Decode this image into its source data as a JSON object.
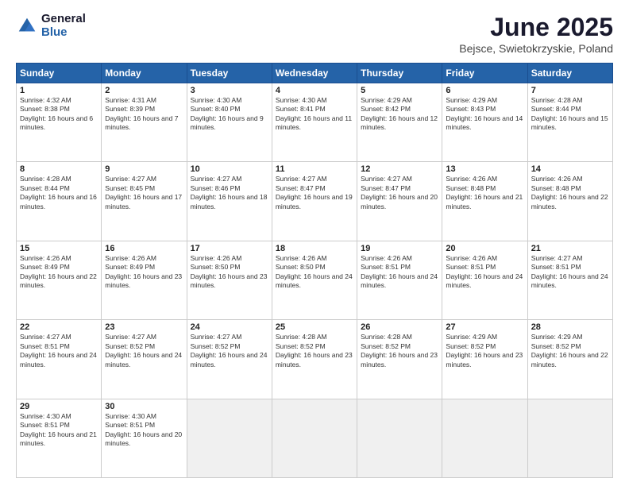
{
  "header": {
    "logo_line1": "General",
    "logo_line2": "Blue",
    "month": "June 2025",
    "location": "Bejsce, Swietokrzyskie, Poland"
  },
  "days_of_week": [
    "Sunday",
    "Monday",
    "Tuesday",
    "Wednesday",
    "Thursday",
    "Friday",
    "Saturday"
  ],
  "weeks": [
    [
      {
        "day": "1",
        "sunrise": "4:32 AM",
        "sunset": "8:38 PM",
        "daylight": "16 hours and 6 minutes."
      },
      {
        "day": "2",
        "sunrise": "4:31 AM",
        "sunset": "8:39 PM",
        "daylight": "16 hours and 7 minutes."
      },
      {
        "day": "3",
        "sunrise": "4:30 AM",
        "sunset": "8:40 PM",
        "daylight": "16 hours and 9 minutes."
      },
      {
        "day": "4",
        "sunrise": "4:30 AM",
        "sunset": "8:41 PM",
        "daylight": "16 hours and 11 minutes."
      },
      {
        "day": "5",
        "sunrise": "4:29 AM",
        "sunset": "8:42 PM",
        "daylight": "16 hours and 12 minutes."
      },
      {
        "day": "6",
        "sunrise": "4:29 AM",
        "sunset": "8:43 PM",
        "daylight": "16 hours and 14 minutes."
      },
      {
        "day": "7",
        "sunrise": "4:28 AM",
        "sunset": "8:44 PM",
        "daylight": "16 hours and 15 minutes."
      }
    ],
    [
      {
        "day": "8",
        "sunrise": "4:28 AM",
        "sunset": "8:44 PM",
        "daylight": "16 hours and 16 minutes."
      },
      {
        "day": "9",
        "sunrise": "4:27 AM",
        "sunset": "8:45 PM",
        "daylight": "16 hours and 17 minutes."
      },
      {
        "day": "10",
        "sunrise": "4:27 AM",
        "sunset": "8:46 PM",
        "daylight": "16 hours and 18 minutes."
      },
      {
        "day": "11",
        "sunrise": "4:27 AM",
        "sunset": "8:47 PM",
        "daylight": "16 hours and 19 minutes."
      },
      {
        "day": "12",
        "sunrise": "4:27 AM",
        "sunset": "8:47 PM",
        "daylight": "16 hours and 20 minutes."
      },
      {
        "day": "13",
        "sunrise": "4:26 AM",
        "sunset": "8:48 PM",
        "daylight": "16 hours and 21 minutes."
      },
      {
        "day": "14",
        "sunrise": "4:26 AM",
        "sunset": "8:48 PM",
        "daylight": "16 hours and 22 minutes."
      }
    ],
    [
      {
        "day": "15",
        "sunrise": "4:26 AM",
        "sunset": "8:49 PM",
        "daylight": "16 hours and 22 minutes."
      },
      {
        "day": "16",
        "sunrise": "4:26 AM",
        "sunset": "8:49 PM",
        "daylight": "16 hours and 23 minutes."
      },
      {
        "day": "17",
        "sunrise": "4:26 AM",
        "sunset": "8:50 PM",
        "daylight": "16 hours and 23 minutes."
      },
      {
        "day": "18",
        "sunrise": "4:26 AM",
        "sunset": "8:50 PM",
        "daylight": "16 hours and 24 minutes."
      },
      {
        "day": "19",
        "sunrise": "4:26 AM",
        "sunset": "8:51 PM",
        "daylight": "16 hours and 24 minutes."
      },
      {
        "day": "20",
        "sunrise": "4:26 AM",
        "sunset": "8:51 PM",
        "daylight": "16 hours and 24 minutes."
      },
      {
        "day": "21",
        "sunrise": "4:27 AM",
        "sunset": "8:51 PM",
        "daylight": "16 hours and 24 minutes."
      }
    ],
    [
      {
        "day": "22",
        "sunrise": "4:27 AM",
        "sunset": "8:51 PM",
        "daylight": "16 hours and 24 minutes."
      },
      {
        "day": "23",
        "sunrise": "4:27 AM",
        "sunset": "8:52 PM",
        "daylight": "16 hours and 24 minutes."
      },
      {
        "day": "24",
        "sunrise": "4:27 AM",
        "sunset": "8:52 PM",
        "daylight": "16 hours and 24 minutes."
      },
      {
        "day": "25",
        "sunrise": "4:28 AM",
        "sunset": "8:52 PM",
        "daylight": "16 hours and 23 minutes."
      },
      {
        "day": "26",
        "sunrise": "4:28 AM",
        "sunset": "8:52 PM",
        "daylight": "16 hours and 23 minutes."
      },
      {
        "day": "27",
        "sunrise": "4:29 AM",
        "sunset": "8:52 PM",
        "daylight": "16 hours and 23 minutes."
      },
      {
        "day": "28",
        "sunrise": "4:29 AM",
        "sunset": "8:52 PM",
        "daylight": "16 hours and 22 minutes."
      }
    ],
    [
      {
        "day": "29",
        "sunrise": "4:30 AM",
        "sunset": "8:51 PM",
        "daylight": "16 hours and 21 minutes."
      },
      {
        "day": "30",
        "sunrise": "4:30 AM",
        "sunset": "8:51 PM",
        "daylight": "16 hours and 20 minutes."
      },
      null,
      null,
      null,
      null,
      null
    ]
  ]
}
